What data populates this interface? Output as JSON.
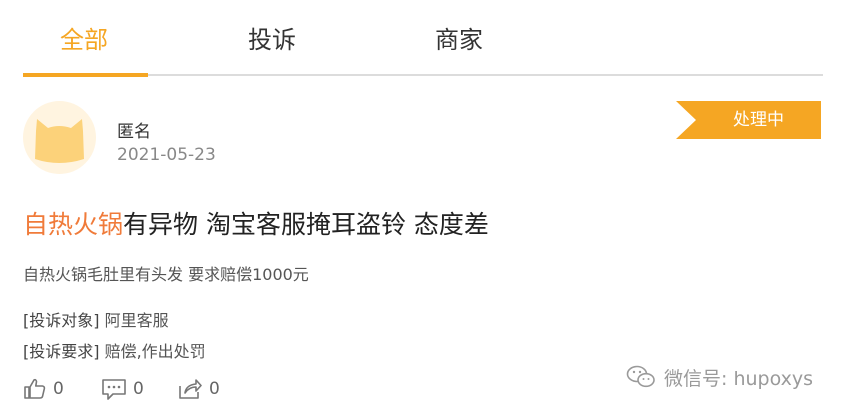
{
  "tabs": [
    {
      "label": "全部",
      "active": true
    },
    {
      "label": "投诉",
      "active": false
    },
    {
      "label": "商家",
      "active": false
    }
  ],
  "post": {
    "author": "匿名",
    "date": "2021-05-23",
    "status": "处理中",
    "title_highlight": "自热火锅",
    "title_rest": "有异物 淘宝客服掩耳盗铃 态度差",
    "description": "自热火锅毛肚里有头发 要求赔偿1000元",
    "target_label": "[投诉对象]",
    "target_value": "阿里客服",
    "request_label": "[投诉要求]",
    "request_value": "赔偿,作出处罚"
  },
  "actions": {
    "likes": "0",
    "comments": "0",
    "shares": "0"
  },
  "watermark": "微信号: hupoxys",
  "colors": {
    "accent": "#f5a623",
    "title_highlight": "#f07b3a",
    "avatar_bg": "#fff4e0",
    "avatar_cat": "#fcd27a"
  }
}
